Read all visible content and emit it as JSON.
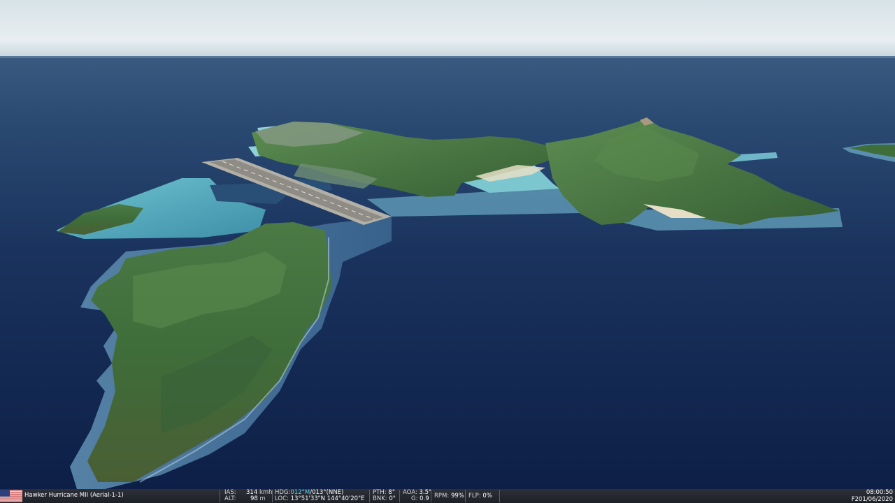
{
  "scene": {
    "description_icon": "aerial-island-view",
    "colors": {
      "sky": "#e3eaee",
      "ocean_far": "#2a4b72",
      "ocean_near": "#0e2148",
      "lagoon": "#47a9b8",
      "vegetation": "#3f6e3a",
      "runway": "#b5b3aa"
    }
  },
  "hud": {
    "flag_icon": "us-flag-icon",
    "aircraft": "Hawker Hurricane MII (Aerial-1-1)",
    "ias_label": "IAS:",
    "ias_value": "314",
    "ias_unit": "kmh",
    "alt_label": "ALT:",
    "alt_value": "98",
    "alt_unit": "m",
    "hdg_label": "HDG:",
    "hdg_mag": "012°M",
    "hdg_true": "/013°(NNE)",
    "loc_label": "LOC:",
    "loc_value": "13°51'33\"N 144°40'20\"E",
    "pth_label": "PTH:",
    "pth_value": "8°",
    "bnk_label": "BNK:",
    "bnk_value": "0°",
    "aoa_label": "AOA:",
    "aoa_value": "3.5°",
    "g_label": "G:",
    "g_value": "0.9",
    "rpm_label": "RPM:",
    "rpm_value": "99%",
    "flp_label": "FLP:",
    "flp_value": "0%",
    "time": "08:00:50",
    "date": "F201/06/2020"
  }
}
